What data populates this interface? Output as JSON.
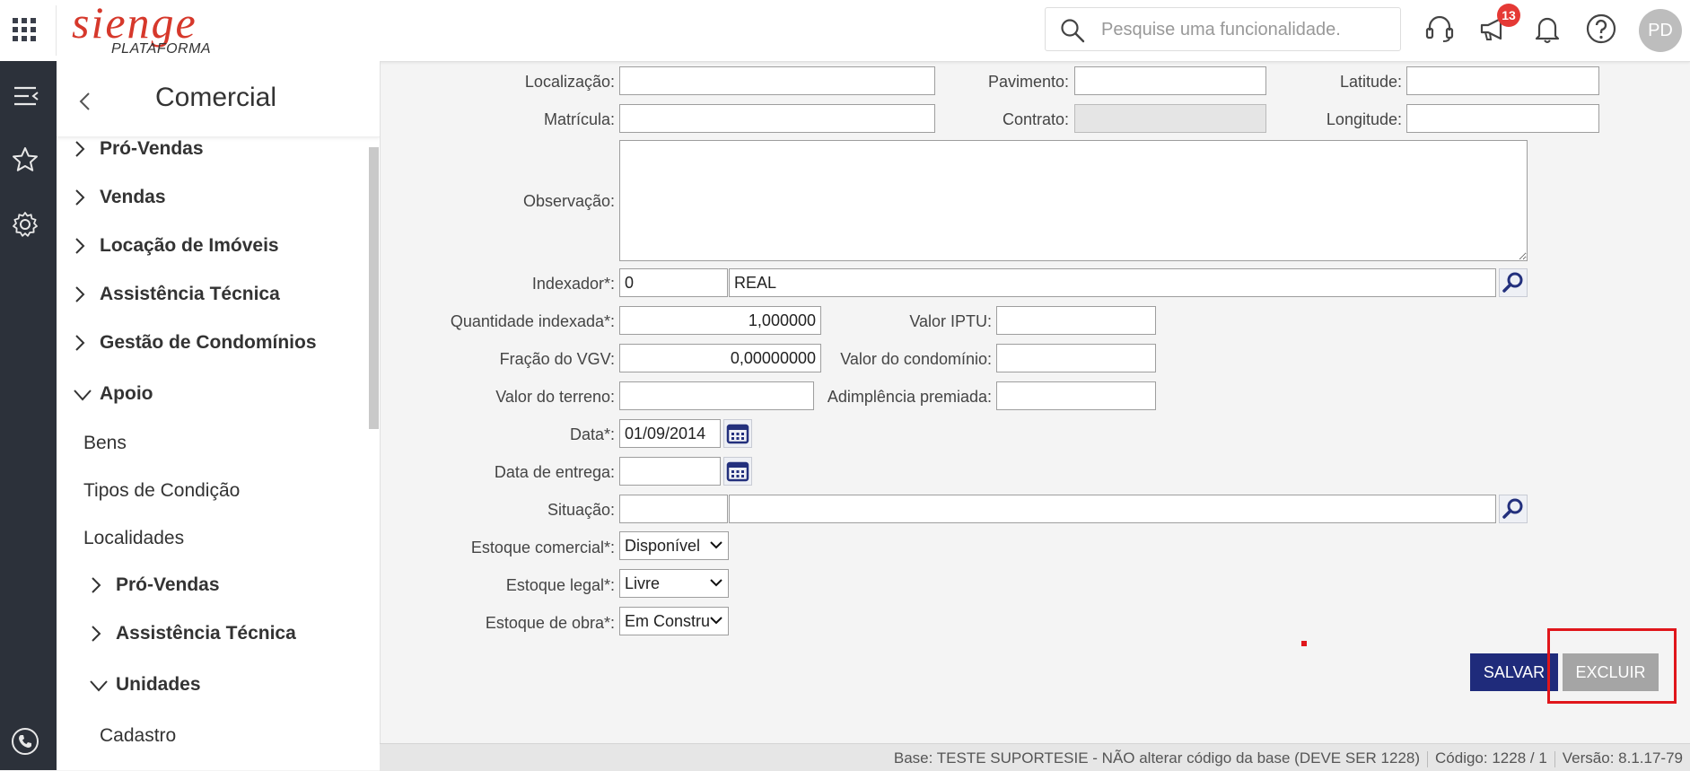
{
  "header": {
    "logo_text": "sienge",
    "logo_sub": "PLATAFORMA",
    "search_placeholder": "Pesquise uma funcionalidade.",
    "notification_count": "13",
    "avatar_initials": "PD"
  },
  "sidebar": {
    "title": "Comercial",
    "items": [
      {
        "label": "Pró-Vendas",
        "type": "group-collapsed"
      },
      {
        "label": "Vendas",
        "type": "group-collapsed"
      },
      {
        "label": "Locação de Imóveis",
        "type": "group-collapsed"
      },
      {
        "label": "Assistência Técnica",
        "type": "group-collapsed"
      },
      {
        "label": "Gestão de Condomínios",
        "type": "group-collapsed"
      },
      {
        "label": "Apoio",
        "type": "group-expanded"
      },
      {
        "label": "Bens",
        "type": "leaf"
      },
      {
        "label": "Tipos de Condição",
        "type": "leaf"
      },
      {
        "label": "Localidades",
        "type": "leaf"
      },
      {
        "label": "Pró-Vendas",
        "type": "subgroup-collapsed"
      },
      {
        "label": "Assistência Técnica",
        "type": "subgroup-collapsed"
      },
      {
        "label": "Unidades",
        "type": "subgroup-expanded"
      },
      {
        "label": "Cadastro",
        "type": "subleaf"
      }
    ]
  },
  "form": {
    "localizacao": {
      "label": "Localização:",
      "value": ""
    },
    "pavimento": {
      "label": "Pavimento:",
      "value": ""
    },
    "latitude": {
      "label": "Latitude:",
      "value": ""
    },
    "matricula": {
      "label": "Matrícula:",
      "value": ""
    },
    "contrato": {
      "label": "Contrato:",
      "value": ""
    },
    "longitude": {
      "label": "Longitude:",
      "value": ""
    },
    "observacao": {
      "label": "Observação:",
      "value": ""
    },
    "indexador": {
      "label": "Indexador*:",
      "code": "0",
      "name": "REAL"
    },
    "quantidade_indexada": {
      "label": "Quantidade indexada*:",
      "value": "1,000000"
    },
    "valor_iptu": {
      "label": "Valor IPTU:",
      "value": ""
    },
    "fracao_vgv": {
      "label": "Fração do VGV:",
      "value": "0,00000000"
    },
    "valor_condominio": {
      "label": "Valor do condomínio:",
      "value": ""
    },
    "valor_terreno": {
      "label": "Valor do terreno:",
      "value": ""
    },
    "adimplencia_premiada": {
      "label": "Adimplência premiada:",
      "value": ""
    },
    "data": {
      "label": "Data*:",
      "value": "01/09/2014"
    },
    "data_entrega": {
      "label": "Data de entrega:",
      "value": ""
    },
    "situacao": {
      "label": "Situação:",
      "code": "",
      "name": ""
    },
    "estoque_comercial": {
      "label": "Estoque comercial*:",
      "value": "Disponível"
    },
    "estoque_legal": {
      "label": "Estoque legal*:",
      "value": "Livre"
    },
    "estoque_obra": {
      "label": "Estoque de obra*:",
      "value": "Em Constru"
    }
  },
  "actions": {
    "salvar": "SALVAR",
    "excluir": "EXCLUIR"
  },
  "footer": {
    "base": "Base: TESTE SUPORTESIE - NÃO alterar código da base (DEVE SER 1228)",
    "codigo": "Código: 1228 / 1",
    "versao": "Versão: 8.1.17-79"
  },
  "colors": {
    "brand_red": "#d6382b",
    "rail_bg": "#2c313a",
    "primary_button": "#1f2b7b",
    "disabled_button": "#a5a5a5",
    "highlight": "#e0161b"
  }
}
